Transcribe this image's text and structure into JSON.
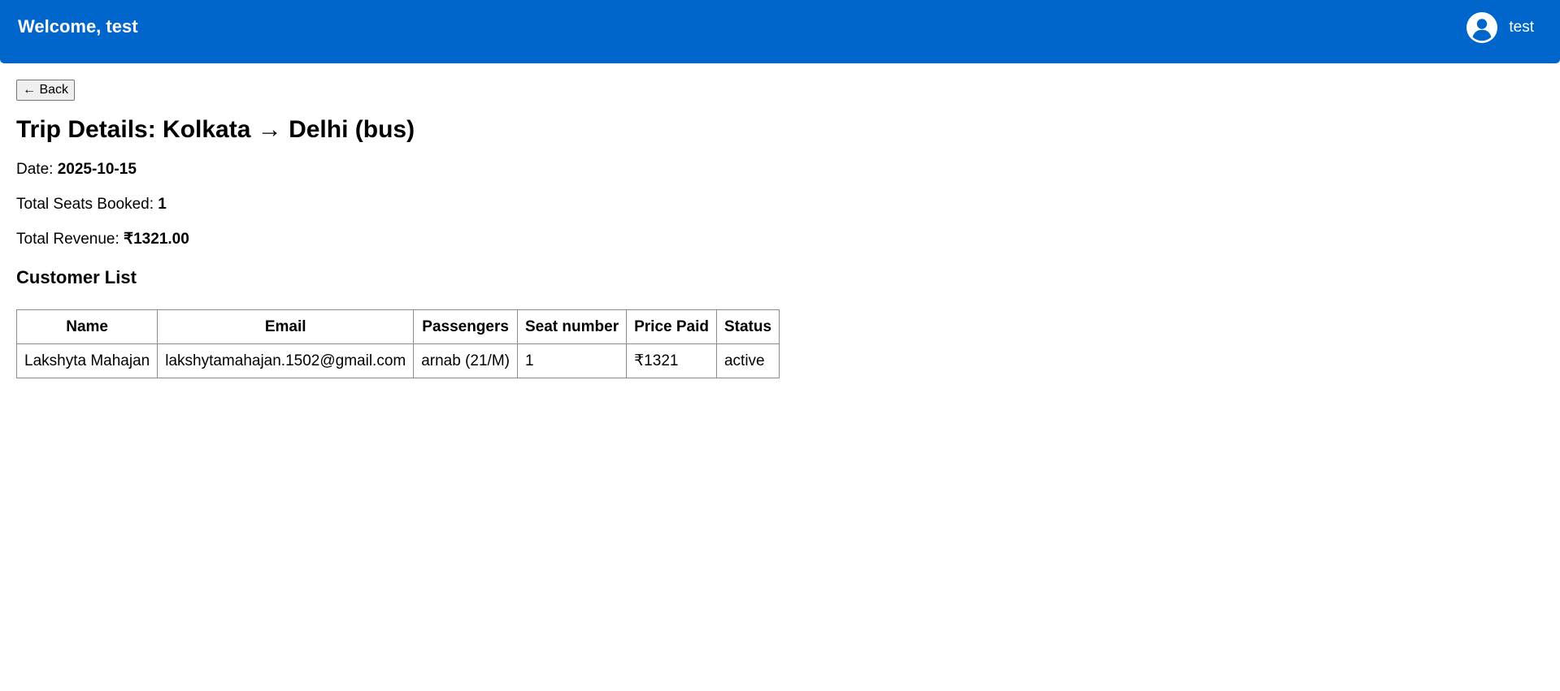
{
  "header": {
    "welcome": "Welcome, test",
    "username": "test",
    "avatar_icon": "user-circle-icon",
    "background_color": "#0066cc"
  },
  "back_button": {
    "label": "← Back"
  },
  "trip": {
    "title": "Trip Details: Kolkata → Delhi (bus)",
    "date_label": "Date: ",
    "date_value": "2025-10-15",
    "seats_label": "Total Seats Booked: ",
    "seats_value": "1",
    "revenue_label": "Total Revenue: ",
    "revenue_value": "₹1321.00"
  },
  "customers": {
    "title": "Customer List",
    "columns": [
      "Name",
      "Email",
      "Passengers",
      "Seat number",
      "Price Paid",
      "Status"
    ],
    "rows": [
      [
        "Lakshyta Mahajan",
        "lakshytamahajan.1502@gmail.com",
        "arnab (21/M)",
        "1",
        "₹1321",
        "active"
      ]
    ]
  }
}
